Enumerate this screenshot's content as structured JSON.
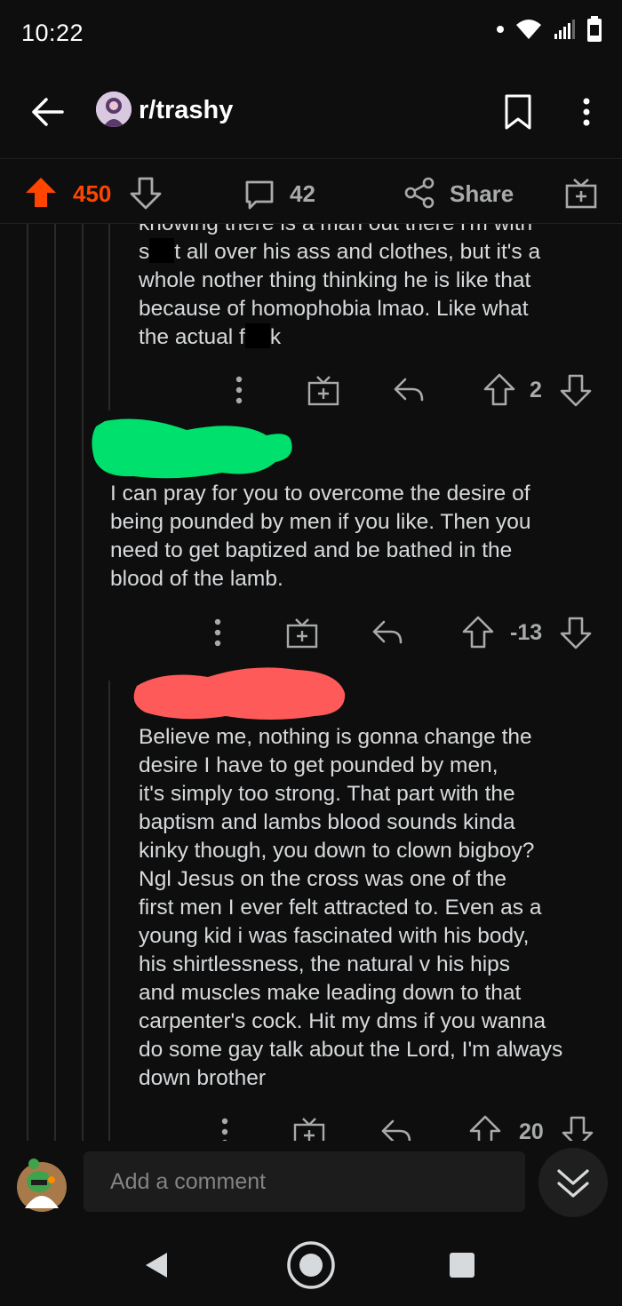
{
  "status_bar": {
    "time": "10:22"
  },
  "header": {
    "subreddit": "r/trashy"
  },
  "vote_bar": {
    "score": "450",
    "comments_count": "42",
    "share_label": "Share"
  },
  "comments": [
    {
      "text_parts": [
        "knowing there is a man out there i'm with\ns",
        "t all over his ass and clothes, but it's a\nwhole nother thing thinking he is like that\nbecause of homophobia lmao. Like what\nthe actual f",
        "k"
      ],
      "score": "2"
    },
    {
      "text": "I can pray for you to overcome the desire of\nbeing pounded by men if you like. Then you\nneed to get baptized and be bathed in the\nblood of the lamb.",
      "score": "-13"
    },
    {
      "text": "Believe me, nothing is gonna change the\ndesire I have to get pounded by men,\nit's simply too strong. That part with the\nbaptism and lambs blood sounds kinda\nkinky though, you down to clown bigboy?\nNgl Jesus on the cross was one of the\nfirst men I ever felt attracted to. Even as a\nyoung kid i was fascinated with his body,\nhis shirtlessness, the natural v his hips\nand muscles make leading down to that\ncarpenter's cock. Hit my dms if you wanna\ndo some gay talk about the Lord, I'm always\ndown brother",
      "score": "20"
    }
  ],
  "comment_input": {
    "placeholder": "Add a comment"
  },
  "colors": {
    "upvote_active": "#ff4500",
    "background": "#0e0e0e",
    "text": "#d7dadc",
    "muted": "#a8aaab",
    "redaction_green": "#00e06c",
    "redaction_red": "#ff5a5a"
  }
}
